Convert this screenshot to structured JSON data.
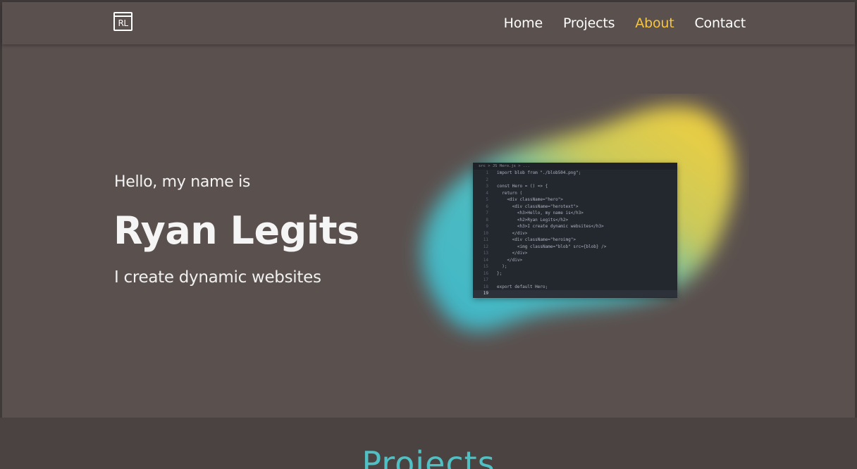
{
  "nav": {
    "logo_text": "RL",
    "links": [
      {
        "label": "Home",
        "active": false
      },
      {
        "label": "Projects",
        "active": false
      },
      {
        "label": "About",
        "active": true
      },
      {
        "label": "Contact",
        "active": false
      }
    ],
    "active_color": "#f5c542"
  },
  "hero": {
    "greeting": "Hello, my name is",
    "name": "Ryan Legits",
    "tagline": "I create dynamic websites"
  },
  "code_window": {
    "tab": "src > JS Hero.js > ...",
    "lines": [
      {
        "n": "1",
        "text": "import blob from \"./blob504.png\";"
      },
      {
        "n": "2",
        "text": ""
      },
      {
        "n": "3",
        "text": "const Hero = () => {"
      },
      {
        "n": "4",
        "text": "  return ("
      },
      {
        "n": "5",
        "text": "    <div className=\"hero\">"
      },
      {
        "n": "6",
        "text": "      <div className=\"herotext\">"
      },
      {
        "n": "7",
        "text": "        <h3>Hello, my name is</h3>"
      },
      {
        "n": "8",
        "text": "        <h2>Ryan Legits</h2>"
      },
      {
        "n": "9",
        "text": "        <h3>I create dynamic websites</h3>"
      },
      {
        "n": "10",
        "text": "      </div>"
      },
      {
        "n": "11",
        "text": "      <div className=\"heroimg\">"
      },
      {
        "n": "12",
        "text": "        <img className=\"blob\" src={blob} />"
      },
      {
        "n": "13",
        "text": "      </div>"
      },
      {
        "n": "14",
        "text": "    </div>"
      },
      {
        "n": "15",
        "text": "  );"
      },
      {
        "n": "16",
        "text": "};"
      },
      {
        "n": "17",
        "text": ""
      },
      {
        "n": "18",
        "text": "export default Hero;"
      },
      {
        "n": "19",
        "text": ""
      }
    ]
  },
  "projects": {
    "title": "Projects"
  }
}
